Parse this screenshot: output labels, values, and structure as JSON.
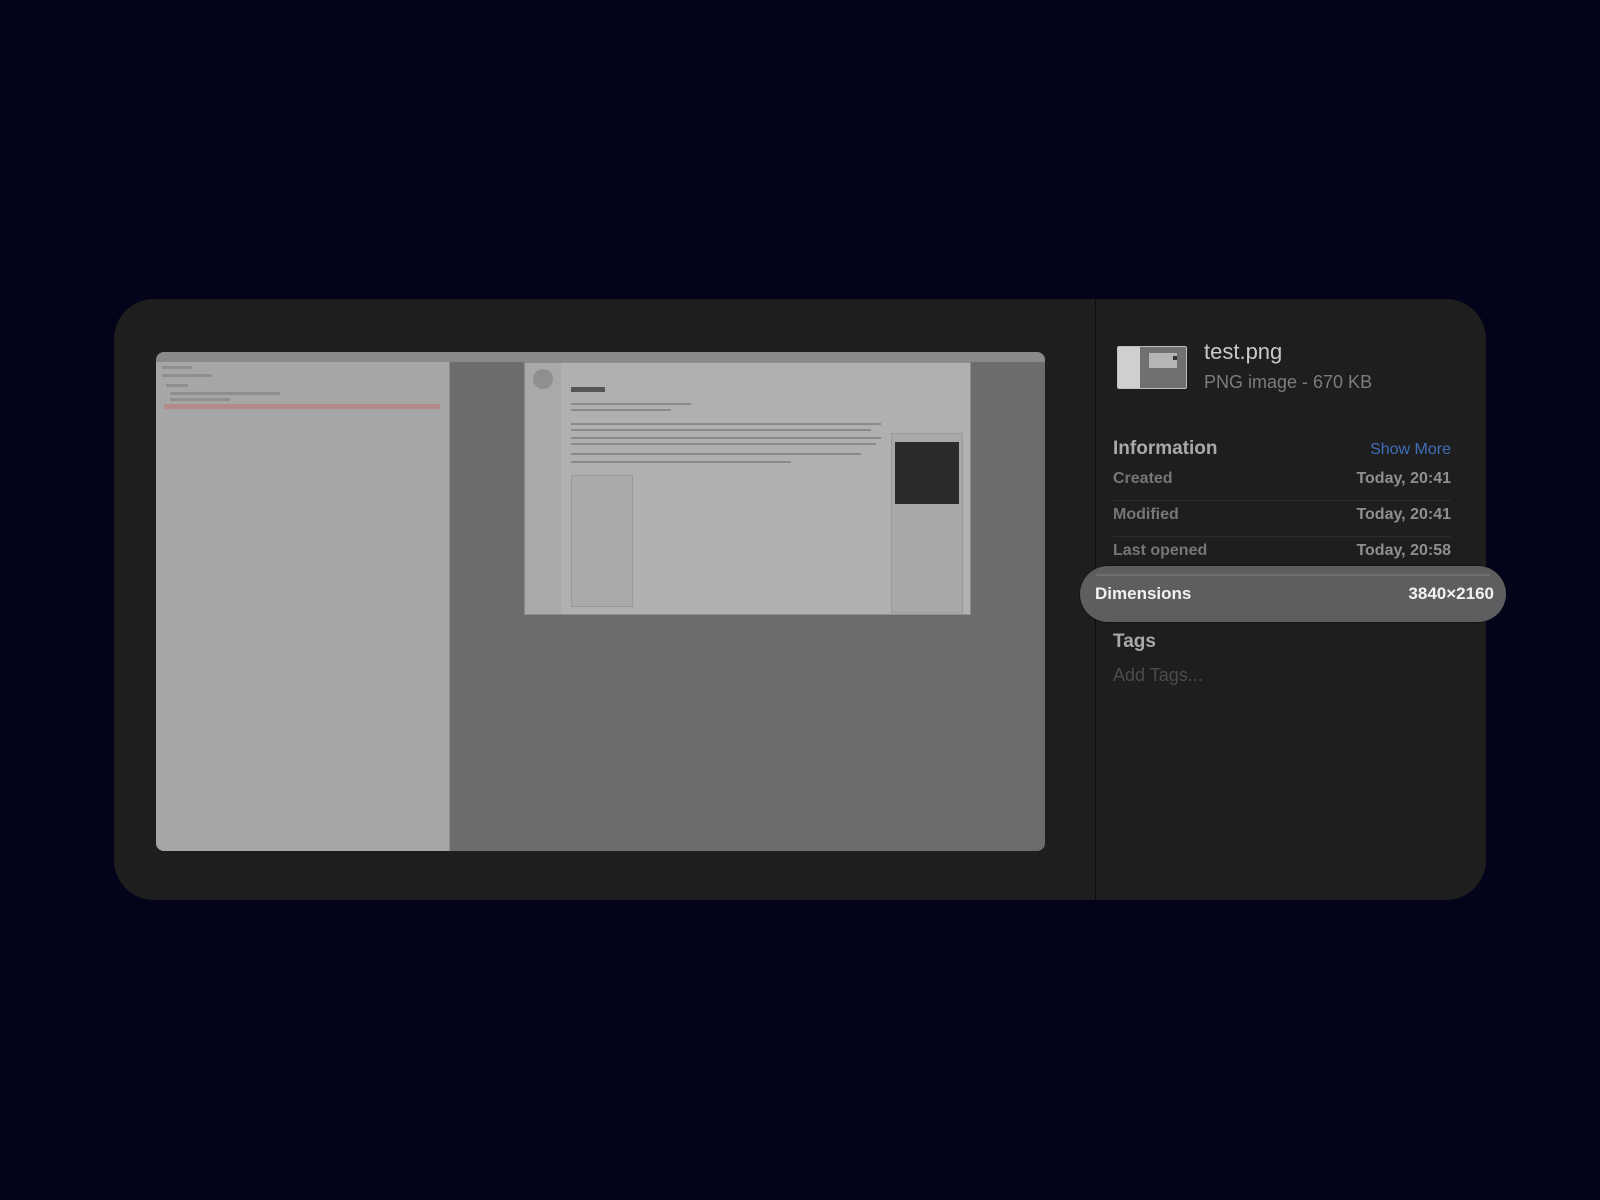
{
  "file": {
    "name": "test.png",
    "type_size": "PNG image - 670 KB"
  },
  "information": {
    "title": "Information",
    "show_more": "Show More",
    "rows": [
      {
        "label": "Created",
        "value": "Today, 20:41"
      },
      {
        "label": "Modified",
        "value": "Today, 20:41"
      },
      {
        "label": "Last opened",
        "value": "Today, 20:58"
      }
    ],
    "dimensions": {
      "label": "Dimensions",
      "value": "3840×2160"
    }
  },
  "tags": {
    "title": "Tags",
    "placeholder": "Add Tags..."
  },
  "colors": {
    "background": "#03041a",
    "panel": "#1e1e1f",
    "link": "#3f6fb8",
    "highlight": "#5e5e61"
  },
  "icons": {
    "thumbnail": "file-thumbnail-icon",
    "preview": "image-preview"
  }
}
